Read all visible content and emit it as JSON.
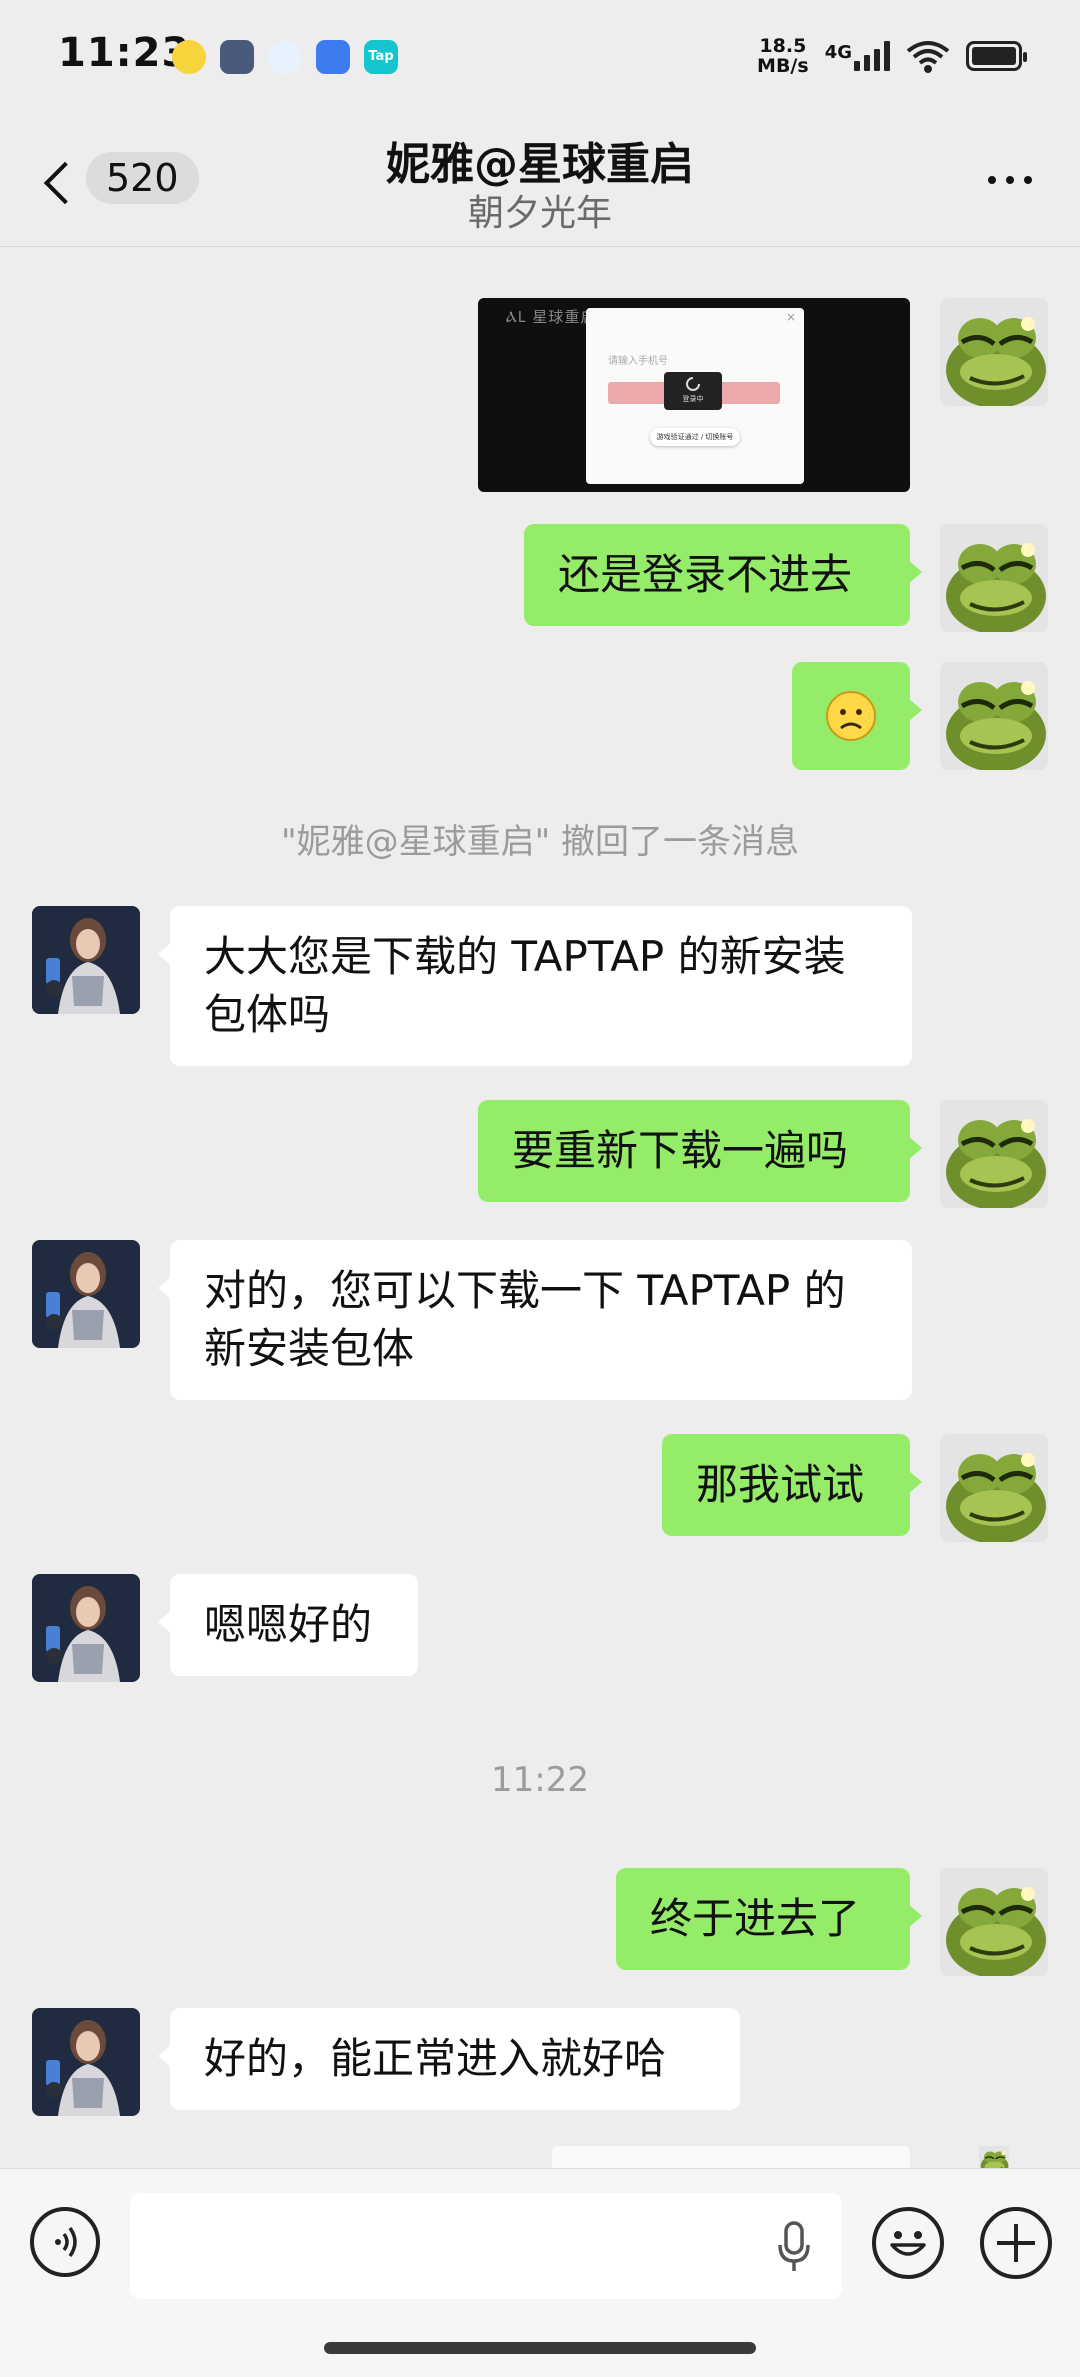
{
  "status_bar": {
    "time": "11:23",
    "net_speed_value": "18.5",
    "net_speed_unit": "MB/s",
    "network": "4G",
    "app_icons": [
      "qq-music-icon",
      "game-icon",
      "qq-icon",
      "browser-icon",
      "taptap-icon"
    ]
  },
  "header": {
    "unread_count": "520",
    "title": "妮雅@星球重启",
    "subtitle": "朝夕光年"
  },
  "screenshot_thumb": {
    "logo_text": "ⲀⳐ 星球重启",
    "placeholder": "请输入手机号",
    "toast": "登录中",
    "pill": "游戏验证通过 / 切换账号"
  },
  "messages": [
    {
      "id": "m1",
      "from": "me",
      "text": "还是登录不进去"
    },
    {
      "id": "m2",
      "from": "me",
      "text": "☹"
    },
    {
      "id": "sys1",
      "from": "system",
      "text": "\"妮雅@星球重启\" 撤回了一条消息"
    },
    {
      "id": "m3",
      "from": "other",
      "text": "大大您是下载的 TAPTAP 的新安装包体吗"
    },
    {
      "id": "m4",
      "from": "me",
      "text": "要重新下载一遍吗"
    },
    {
      "id": "m5",
      "from": "other",
      "text": "对的，您可以下载一下 TAPTAP 的新安装包体"
    },
    {
      "id": "m6",
      "from": "me",
      "text": "那我试试"
    },
    {
      "id": "m7",
      "from": "other",
      "text": "嗯嗯好的"
    },
    {
      "id": "sys2",
      "from": "system",
      "text": "11:22"
    },
    {
      "id": "m8",
      "from": "me",
      "text": "终于进去了"
    },
    {
      "id": "m9",
      "from": "other",
      "text": "好的，能正常进入就好哈"
    }
  ],
  "colors": {
    "background": "#ededed",
    "my_bubble": "#95ec69",
    "their_bubble": "#ffffff",
    "system_text": "#9b9b9b"
  },
  "input_bar": {
    "voice_icon": "voice-mode-icon",
    "mic_icon": "microphone-icon",
    "emoji_icon": "emoji-icon",
    "plus_icon": "plus-icon"
  }
}
